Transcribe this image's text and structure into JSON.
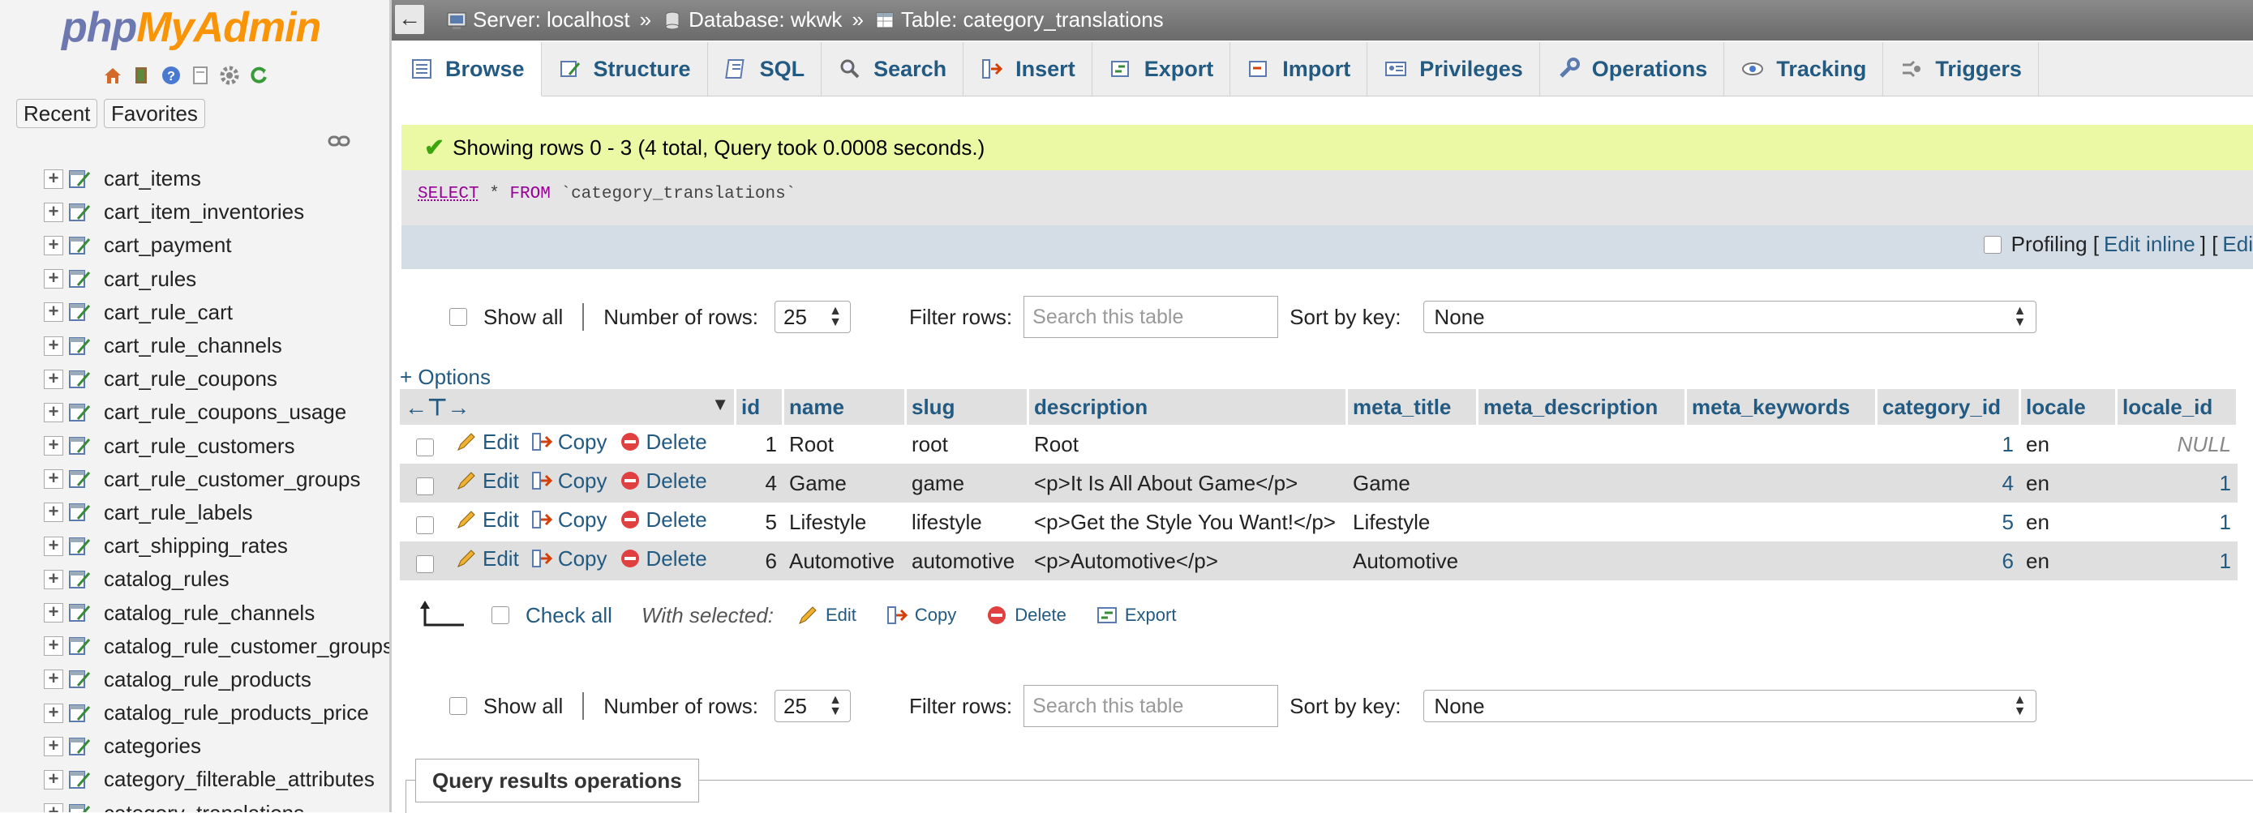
{
  "app": {
    "logo_part1": "php",
    "logo_part2": "MyAdmin"
  },
  "sidebar": {
    "recent_label": "Recent",
    "favorites_label": "Favorites",
    "tables": [
      "cart_items",
      "cart_item_inventories",
      "cart_payment",
      "cart_rules",
      "cart_rule_cart",
      "cart_rule_channels",
      "cart_rule_coupons",
      "cart_rule_coupons_usage",
      "cart_rule_customers",
      "cart_rule_customer_groups",
      "cart_rule_labels",
      "cart_shipping_rates",
      "catalog_rules",
      "catalog_rule_channels",
      "catalog_rule_customer_groups",
      "catalog_rule_products",
      "catalog_rule_products_price",
      "categories",
      "category_filterable_attributes",
      "category_translations"
    ]
  },
  "breadcrumb": {
    "server": "Server: localhost",
    "database": "Database: wkwk",
    "table": "Table: category_translations",
    "separator": "»"
  },
  "tabs": [
    "Browse",
    "Structure",
    "SQL",
    "Search",
    "Insert",
    "Export",
    "Import",
    "Privileges",
    "Operations",
    "Tracking",
    "Triggers"
  ],
  "message": {
    "success": "Showing rows 0 - 3 (4 total, Query took 0.0008 seconds.)"
  },
  "query": {
    "kw_select": "SELECT",
    "star": " * ",
    "kw_from": "FROM",
    "table": " `category_translations`"
  },
  "profiling": {
    "label": "Profiling [",
    "edit_inline": "Edit inline",
    "mid": "] [ ",
    "edit": "Edi"
  },
  "nav": {
    "show_all": "Show all",
    "number_of_rows_label": "Number of rows:",
    "number_of_rows_value": "25",
    "filter_label": "Filter rows:",
    "filter_placeholder": "Search this table",
    "sort_label": "Sort by key:",
    "sort_value": "None"
  },
  "options_link": "+ Options",
  "table": {
    "columns": [
      "id",
      "name",
      "slug",
      "description",
      "meta_title",
      "meta_description",
      "meta_keywords",
      "category_id",
      "locale",
      "locale_id"
    ],
    "row_actions": {
      "edit": "Edit",
      "copy": "Copy",
      "delete": "Delete"
    },
    "rows": [
      {
        "id": "1",
        "name": "Root",
        "slug": "root",
        "description": "Root",
        "meta_title": "",
        "meta_description": "",
        "meta_keywords": "",
        "category_id": "1",
        "locale": "en",
        "locale_id": "NULL"
      },
      {
        "id": "4",
        "name": "Game",
        "slug": "game",
        "description": "<p>It Is All About Game</p>",
        "meta_title": "Game",
        "meta_description": "",
        "meta_keywords": "",
        "category_id": "4",
        "locale": "en",
        "locale_id": "1"
      },
      {
        "id": "5",
        "name": "Lifestyle",
        "slug": "lifestyle",
        "description": "<p>Get the Style You Want!</p>",
        "meta_title": "Lifestyle",
        "meta_description": "",
        "meta_keywords": "",
        "category_id": "5",
        "locale": "en",
        "locale_id": "1"
      },
      {
        "id": "6",
        "name": "Automotive",
        "slug": "automotive",
        "description": "<p>Automotive</p>",
        "meta_title": "Automotive",
        "meta_description": "",
        "meta_keywords": "",
        "category_id": "6",
        "locale": "en",
        "locale_id": "1"
      }
    ]
  },
  "with_selected": {
    "check_all": "Check all",
    "label": "With selected:",
    "edit": "Edit",
    "copy": "Copy",
    "delete": "Delete",
    "export": "Export"
  },
  "query_results_operations": "Query results operations",
  "colors": {
    "link": "#235a81",
    "success_bg": "#ebf8a4",
    "top_bar": "#7a7a7a",
    "logo_blue": "#6c78af",
    "logo_orange": "#f89406"
  }
}
